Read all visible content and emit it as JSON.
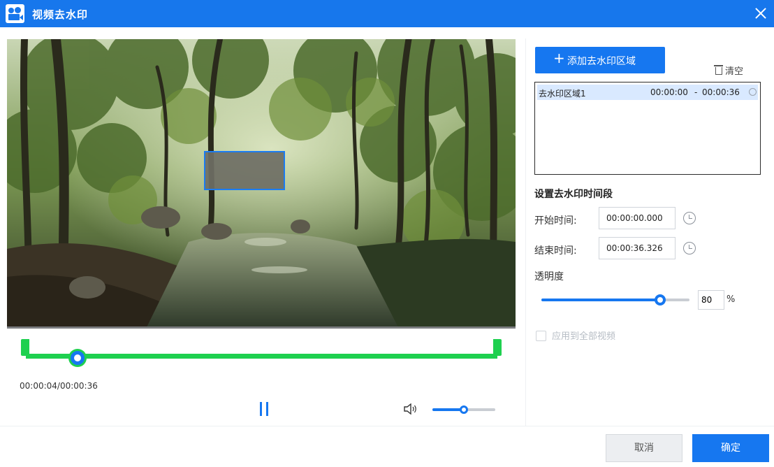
{
  "window": {
    "title": "视频去水印",
    "icon": "camera-icon",
    "close_icon": "close-icon"
  },
  "player": {
    "timecode": "00:00:04/00:00:36",
    "playback_fraction": 0.11,
    "volume_fraction": 0.5,
    "pause_icon": "pause-icon",
    "volume_icon": "speaker-icon"
  },
  "settings": {
    "add_region_label": "添加去水印区域",
    "clear_label": "清空",
    "regions": [
      {
        "name": "去水印区域1",
        "start": "00:00:00",
        "dash": "-",
        "end": "00:00:36"
      }
    ],
    "section_title": "设置去水印时间段",
    "start_label": "开始时间:",
    "start_value": "00:00:00.000",
    "end_label": "结束时间:",
    "end_value": "00:00:36.326",
    "opacity_label": "透明度",
    "opacity_value": "80",
    "opacity_unit": "%",
    "opacity_fraction": 0.8,
    "apply_all_label": "应用到全部视频"
  },
  "footer": {
    "cancel_label": "取消",
    "ok_label": "确定"
  },
  "colors": {
    "accent": "#1677f0",
    "titlebar": "#1777ec",
    "timeline": "#1ed04f"
  }
}
